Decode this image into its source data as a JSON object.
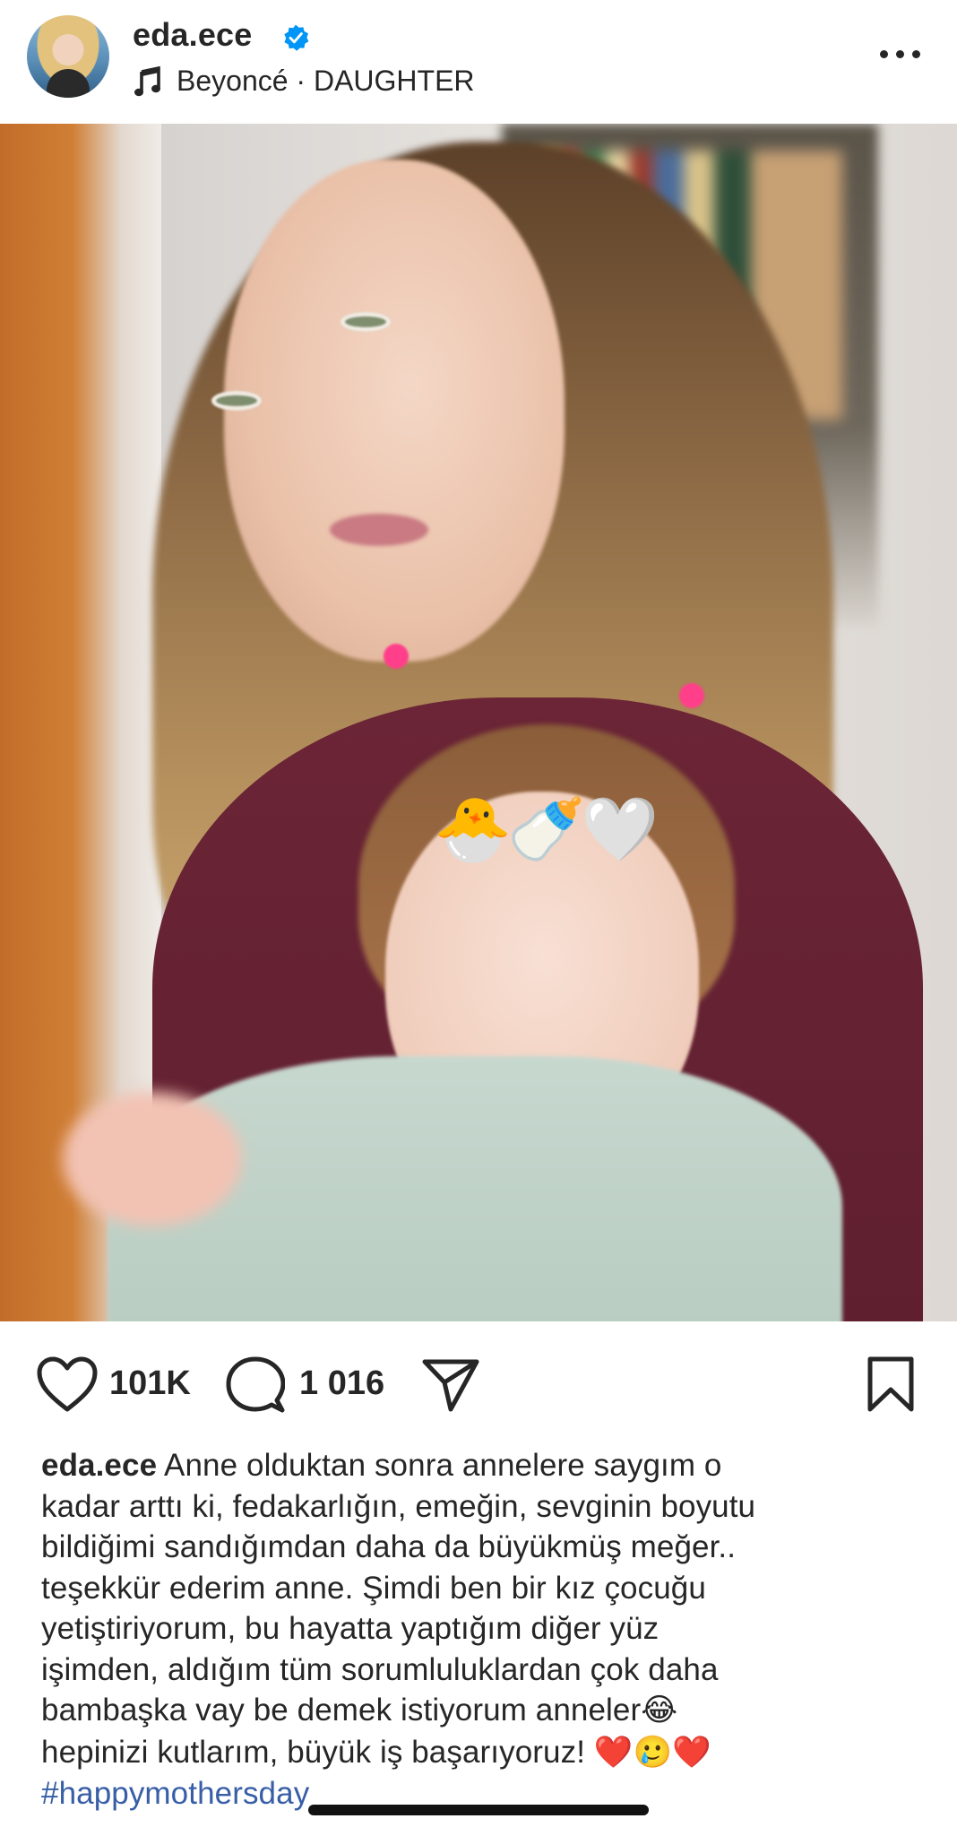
{
  "header": {
    "username": "eda.ece",
    "verified": true,
    "audio": "Beyoncé · DAUGHTER"
  },
  "media": {
    "sticker_emojis": [
      "🐣",
      "🍼",
      "🤍"
    ],
    "muted": true
  },
  "actions": {
    "likes": "101K",
    "comments": "1 016"
  },
  "caption": {
    "username": "eda.ece",
    "lines": [
      "Anne olduktan sonra annelere saygım o",
      "kadar arttı ki, fedakarlığın, emeğin, sevginin boyutu",
      "bildiğimi sandığımdan daha da büyükmüş meğer..",
      "teşekkür ederim anne. Şimdi ben bir kız çocuğu",
      "yetiştiriyorum, bu hayatta yaptığım diğer yüz",
      "işimden, aldığım tüm sorumluluklardan çok daha",
      "bambaşka vay be demek istiyorum anneler",
      "hepinizi kutlarım, büyük iş başarıyoruz!"
    ],
    "emoji_laugh": "😂",
    "emoji_end": "❤️🥲❤️",
    "hashtag": "#happymothersday"
  },
  "colors": {
    "text": "#262626",
    "link": "#385ea7",
    "verified": "#0095f6",
    "heart_red": "#ed1c24"
  }
}
